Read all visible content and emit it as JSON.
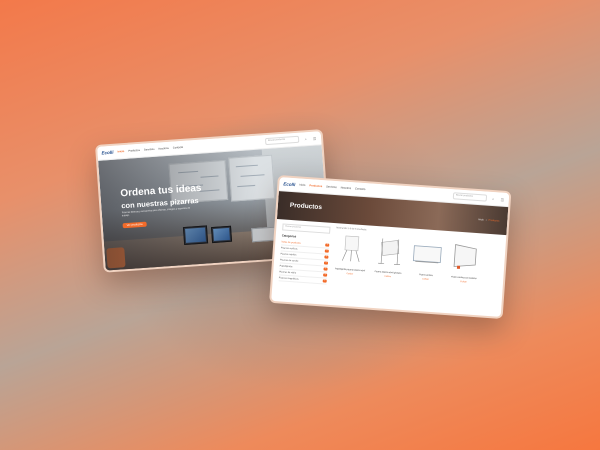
{
  "home": {
    "logo": "Ecolli",
    "nav": [
      "Inicio",
      "Productos",
      "Servicios",
      "Nosotros",
      "Contacto"
    ],
    "search_placeholder": "Buscar productos",
    "hero_title": "Ordena tus ideas",
    "hero_subtitle": "con nuestras pizarras",
    "hero_text": "Pizarras blancas y accesorios para oficinas, colegios y espacios de trabajo.",
    "hero_button": "Ver productos"
  },
  "products": {
    "logo": "Ecolli",
    "nav": [
      "Inicio",
      "Productos",
      "Servicios",
      "Nosotros",
      "Contacto"
    ],
    "search_placeholder": "Buscar productos",
    "banner_title": "Productos",
    "breadcrumb": [
      "Inicio",
      "›",
      "Productos"
    ],
    "sidebar": {
      "search_placeholder": "Buscar productos",
      "header": "Categorías",
      "categories": [
        {
          "label": "Todos los productos",
          "count": "9"
        },
        {
          "label": "Pizarras acrílicas",
          "count": "3"
        },
        {
          "label": "Pizarras móviles",
          "count": "2"
        },
        {
          "label": "Pizarras de corcho",
          "count": "1"
        },
        {
          "label": "Papelógrafos",
          "count": "1"
        },
        {
          "label": "Pizarras de vidrio",
          "count": "1"
        },
        {
          "label": "Pizarras magnéticas",
          "count": "1"
        }
      ]
    },
    "results_text": "Mostrando 1–9 de 9 resultados",
    "items": [
      {
        "name": "Papelógrafo pizarra blanca móvil",
        "price": "Cotizar"
      },
      {
        "name": "Pizarra blanca móvil giratoria",
        "price": "Cotizar"
      },
      {
        "name": "Pizarra acrílica",
        "price": "Cotizar"
      },
      {
        "name": "Pizarra acrílica con bastidor",
        "price": "Cotizar"
      }
    ]
  }
}
